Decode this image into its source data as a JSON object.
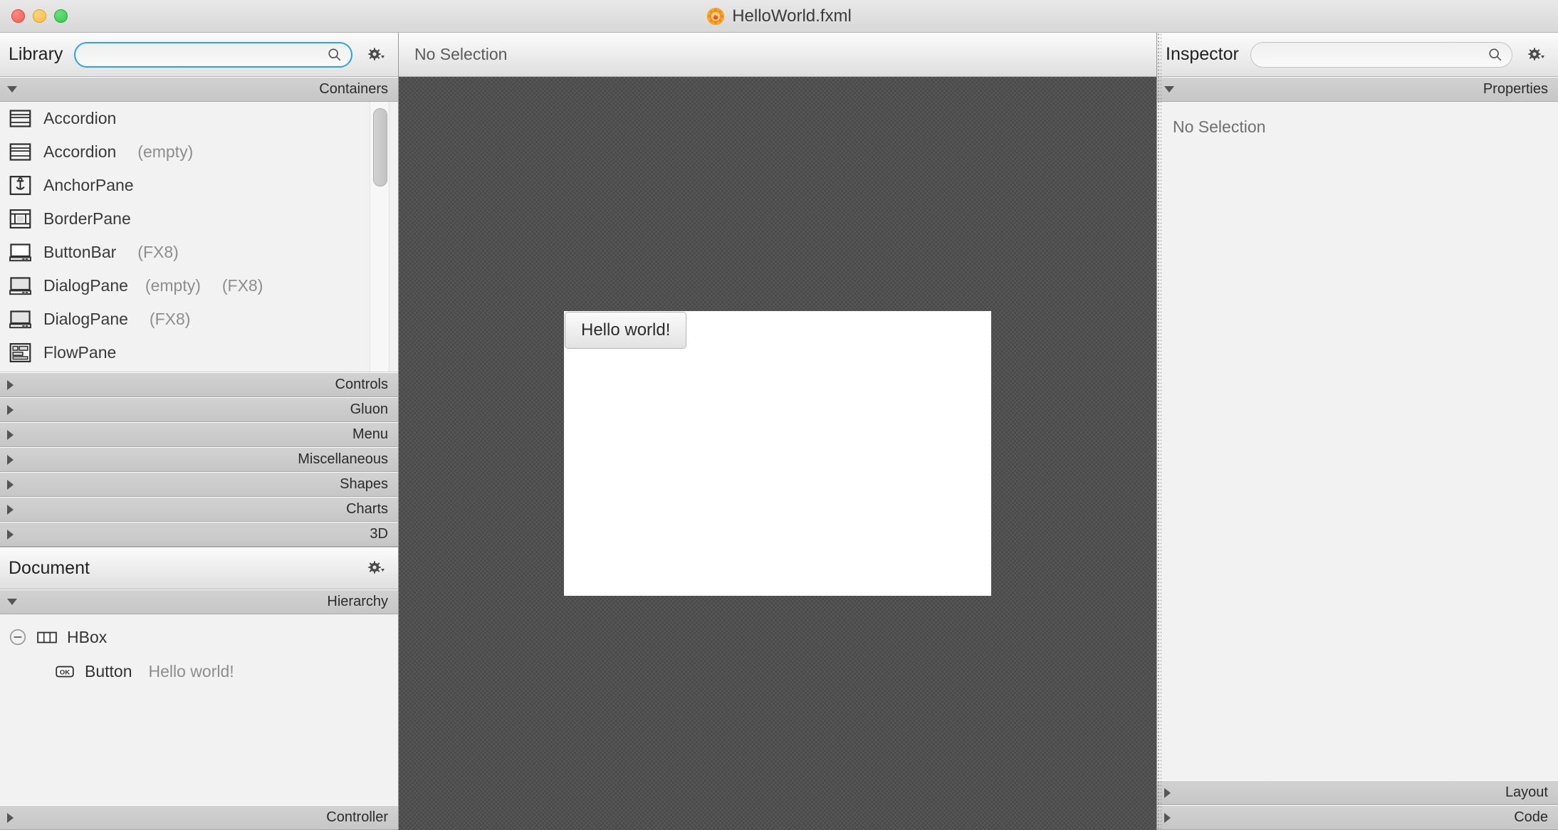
{
  "window": {
    "title": "HelloWorld.fxml",
    "app_icon": "scenebuilder-icon",
    "traffic_lights": [
      "close-button",
      "minimize-button",
      "zoom-button"
    ]
  },
  "library": {
    "title": "Library",
    "search": {
      "value": "",
      "placeholder": ""
    },
    "search_icon": "search-icon",
    "gear_icon": "gear-icon",
    "sections": [
      {
        "label": "Containers",
        "expanded": true
      },
      {
        "label": "Controls",
        "expanded": false
      },
      {
        "label": "Gluon",
        "expanded": false
      },
      {
        "label": "Menu",
        "expanded": false
      },
      {
        "label": "Miscellaneous",
        "expanded": false
      },
      {
        "label": "Shapes",
        "expanded": false
      },
      {
        "label": "Charts",
        "expanded": false
      },
      {
        "label": "3D",
        "expanded": false
      }
    ],
    "items": [
      {
        "name": "Accordion",
        "suffix": "",
        "suffix2": "",
        "icon": "accordion-icon"
      },
      {
        "name": "Accordion",
        "suffix": "(empty)",
        "suffix2": "",
        "icon": "accordion-icon"
      },
      {
        "name": "AnchorPane",
        "suffix": "",
        "suffix2": "",
        "icon": "anchorpane-icon"
      },
      {
        "name": "BorderPane",
        "suffix": "",
        "suffix2": "",
        "icon": "borderpane-icon"
      },
      {
        "name": "ButtonBar",
        "suffix": "(FX8)",
        "suffix2": "",
        "icon": "buttonbar-icon"
      },
      {
        "name": "DialogPane",
        "suffix": "(empty)",
        "suffix2": "(FX8)",
        "icon": "dialogpane-icon"
      },
      {
        "name": "DialogPane",
        "suffix": "(FX8)",
        "suffix2": "",
        "icon": "dialogpane-icon"
      },
      {
        "name": "FlowPane",
        "suffix": "",
        "suffix2": "",
        "icon": "flowpane-icon"
      }
    ]
  },
  "document": {
    "title": "Document",
    "gear_icon": "gear-icon",
    "hierarchy": {
      "label": "Hierarchy",
      "expanded": true
    },
    "tree": [
      {
        "depth": 0,
        "icon": "hbox-icon",
        "name": "HBox",
        "value": "",
        "disclosure": "collapse-icon"
      },
      {
        "depth": 1,
        "icon": "button-icon",
        "name": "Button",
        "value": "Hello world!",
        "disclosure": ""
      }
    ],
    "controller": {
      "label": "Controller",
      "expanded": false
    }
  },
  "content": {
    "selection_status": "No Selection",
    "stage": {
      "button_label": "Hello world!"
    }
  },
  "inspector": {
    "title": "Inspector",
    "search": {
      "value": "",
      "placeholder": ""
    },
    "search_icon": "search-icon",
    "gear_icon": "gear-icon",
    "properties": {
      "label": "Properties",
      "expanded": true
    },
    "empty_text": "No Selection",
    "sections": [
      {
        "label": "Layout",
        "expanded": false
      },
      {
        "label": "Code",
        "expanded": false
      }
    ]
  },
  "colors": {
    "accent": "#29a3ec",
    "canvas_bg": "#4a4a4a",
    "panel_bg": "#f2f2f2",
    "section_bg": "#cccccc"
  }
}
